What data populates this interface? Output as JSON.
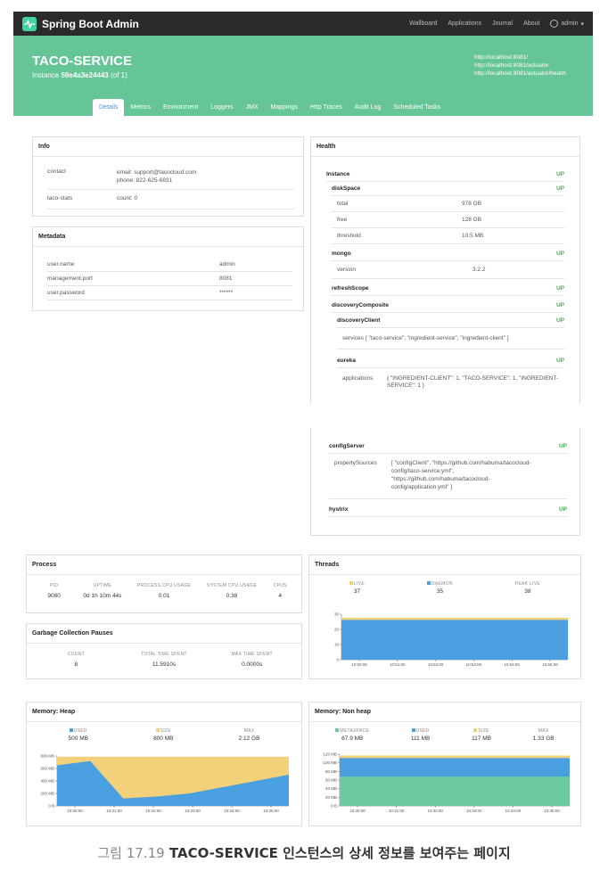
{
  "navbar": {
    "brand": "Spring Boot Admin",
    "links": [
      "Wallboard",
      "Applications",
      "Journal",
      "About"
    ],
    "user": "admin"
  },
  "header": {
    "app_name": "TACO-SERVICE",
    "instance_label": "Instance",
    "instance_id": "59e4a3e24443",
    "instance_count": "(of 1)",
    "urls": [
      "http://localhost:8081/",
      "http://localhost:8081/actuator",
      "http://localhost:8081/actuator/health"
    ]
  },
  "tabs": [
    "Details",
    "Metrics",
    "Environment",
    "Loggers",
    "JMX",
    "Mappings",
    "Http Traces",
    "Audit Log",
    "Scheduled Tasks"
  ],
  "info": {
    "title": "Info",
    "rows": [
      {
        "key": "contact",
        "value1": "email: support@tacocloud.com",
        "value2": "phone: 822-625-6831"
      },
      {
        "key": "taco-stats",
        "value1": "count: 0",
        "value2": ""
      }
    ]
  },
  "metadata": {
    "title": "Metadata",
    "rows": [
      {
        "key": "user.name",
        "value": "admin"
      },
      {
        "key": "management.port",
        "value": "8081"
      },
      {
        "key": "user.password",
        "value": "******"
      }
    ]
  },
  "health": {
    "title": "Health",
    "instance": {
      "label": "Instance",
      "status": "UP"
    },
    "diskspace": {
      "label": "diskSpace",
      "status": "UP",
      "rows": [
        [
          "total",
          "978 GB"
        ],
        [
          "free",
          "128 GB"
        ],
        [
          "threshold",
          "10.5 MB"
        ]
      ]
    },
    "mongo": {
      "label": "mongo",
      "status": "UP",
      "rows": [
        [
          "version",
          "3.2.2"
        ]
      ]
    },
    "refreshscope": {
      "label": "refreshScope",
      "status": "UP"
    },
    "discoverycomposite": {
      "label": "discoveryComposite",
      "status": "UP"
    },
    "discoveryclient": {
      "label": "discoveryClient",
      "status": "UP",
      "services_key": "services",
      "services_value": "[ \"taco-service\", \"ingredient-service\", \"ingredient-client\" ]"
    },
    "eureka": {
      "label": "eureka",
      "status": "UP",
      "apps_key": "applications",
      "apps_value1": "{ \"INGREDIENT-CLIENT\": 1, \"TACO-SERVICE\": 1, \"INGREDIENT-",
      "apps_value2": "SERVICE\": 1 }"
    },
    "configserver": {
      "label": "configServer",
      "status": "UP",
      "ps_key": "propertySources",
      "ps_lines": [
        "[ \"configClient\", \"https://github.com/habuma/tacocloud-",
        "config/taco-service.yml\",",
        "\"https://github.com/habuma/tacocloud-",
        "config/application.yml\" ]"
      ]
    },
    "hystrix": {
      "label": "hystrix",
      "status": "UP"
    }
  },
  "process": {
    "title": "Process",
    "headers": [
      "PID",
      "UPTIME",
      "PROCESS CPU USAGE",
      "SYSTEM CPU USAGE",
      "CPUS"
    ],
    "values": [
      "9080",
      "0d 1h 10m 44s",
      "0.01",
      "0.38",
      "4"
    ]
  },
  "gc": {
    "title": "Garbage Collection Pauses",
    "headers": [
      "COUNT",
      "TOTAL TIME SPENT",
      "MAX TIME SPENT"
    ],
    "values": [
      "8",
      "11.5910s",
      "0.0000s"
    ]
  },
  "threads": {
    "title": "Threads",
    "legend": [
      {
        "name": "LIVE",
        "value": "37"
      },
      {
        "name": "DAEMON",
        "value": "35"
      },
      {
        "name": "PEAK LIVE",
        "value": "38"
      }
    ]
  },
  "heap": {
    "title": "Memory: Heap",
    "legend": [
      {
        "name": "USED",
        "value": "500 MB"
      },
      {
        "name": "SIZE",
        "value": "800 MB"
      },
      {
        "name": "MAX",
        "value": "2.12 GB"
      }
    ]
  },
  "nonheap": {
    "title": "Memory: Non heap",
    "legend": [
      {
        "name": "METASPACE",
        "value": "67.9 MB"
      },
      {
        "name": "USED",
        "value": "111 MB"
      },
      {
        "name": "SIZE",
        "value": "117 MB"
      },
      {
        "name": "MAX",
        "value": "1.33 GB"
      }
    ]
  },
  "colors": {
    "green_header": "#66c597",
    "used_blue": "#4a9fe0",
    "size_yellow": "#f3d07a",
    "meta_green": "#6cc9a0",
    "up_green": "#4caf50"
  },
  "chart_data": [
    {
      "type": "area",
      "title": "Threads",
      "x": [
        "10:50:00",
        "10:51:00",
        "10:52:00",
        "10:53:00",
        "10:54:00",
        "10:55:00"
      ],
      "ylim": [
        0,
        40
      ],
      "yticks": [
        "0",
        "10",
        "20",
        "30"
      ],
      "series": [
        {
          "name": "LIVE",
          "values": [
            37,
            37,
            37,
            37,
            37,
            37
          ]
        },
        {
          "name": "DAEMON",
          "values": [
            35,
            35,
            35,
            35,
            35,
            35
          ]
        }
      ]
    },
    {
      "type": "area",
      "title": "Memory: Heap",
      "x": [
        "10:30:00",
        "10:31:00",
        "10:32:00",
        "10:33:00",
        "10:34:00",
        "10:35:00"
      ],
      "ylim": [
        0,
        800
      ],
      "yticks": [
        "0 B",
        "200 MB",
        "400 MB",
        "600 MB",
        "800 MB"
      ],
      "series": [
        {
          "name": "SIZE",
          "values": [
            790,
            790,
            790,
            790,
            790,
            790,
            790,
            790
          ]
        },
        {
          "name": "USED",
          "values": [
            650,
            720,
            120,
            150,
            200,
            300,
            400,
            500
          ]
        }
      ]
    },
    {
      "type": "area",
      "title": "Memory: Non heap",
      "x": [
        "10:30:00",
        "10:31:00",
        "10:32:00",
        "10:33:00",
        "10:34:00",
        "10:35:00"
      ],
      "ylim": [
        0,
        120
      ],
      "yticks": [
        "0 B",
        "20 MB",
        "40 MB",
        "60 MB",
        "80 MB",
        "100 MB",
        "120 MB"
      ],
      "series": [
        {
          "name": "SIZE",
          "values": [
            117,
            117,
            117,
            117,
            117,
            117
          ]
        },
        {
          "name": "USED",
          "values": [
            111,
            111,
            111,
            111,
            111,
            111
          ]
        },
        {
          "name": "METASPACE",
          "values": [
            67.9,
            67.9,
            67.9,
            67.9,
            67.9,
            67.9
          ]
        }
      ]
    }
  ],
  "caption": {
    "number": "그림 17.19",
    "text": "TACO-SERVICE 인스턴스의 상세 정보를 보여주는 페이지"
  }
}
